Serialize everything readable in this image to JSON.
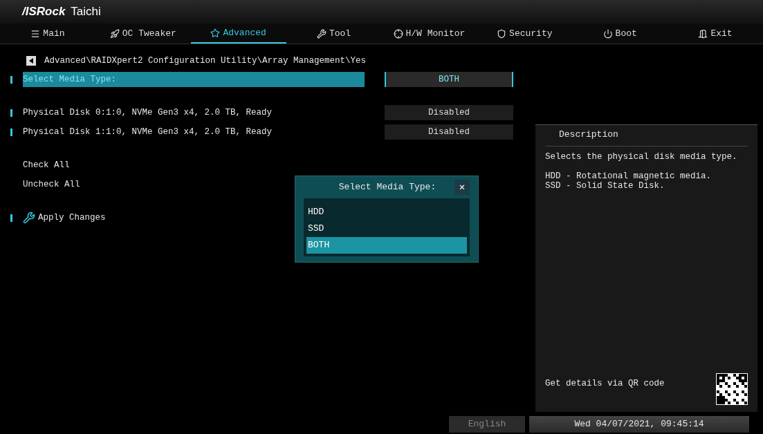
{
  "brand": {
    "logo": "/ISRock",
    "model": "Taichi"
  },
  "tabs": [
    {
      "label": "Main",
      "kind": "menu",
      "selected": false
    },
    {
      "label": "OC Tweaker",
      "kind": "rocket",
      "selected": false
    },
    {
      "label": "Advanced",
      "kind": "star",
      "selected": true
    },
    {
      "label": "Tool",
      "kind": "tools",
      "selected": false
    },
    {
      "label": "H/W Monitor",
      "kind": "target",
      "selected": false
    },
    {
      "label": "Security",
      "kind": "shield",
      "selected": false
    },
    {
      "label": "Boot",
      "kind": "power",
      "selected": false
    },
    {
      "label": "Exit",
      "kind": "door",
      "selected": false
    }
  ],
  "breadcrumb": "Advanced\\RAIDXpert2 Configuration Utility\\Array Management\\Yes",
  "groups": [
    [
      {
        "kind": "option",
        "label": "Select Media Type:",
        "value": "BOTH",
        "selected": true
      }
    ],
    [
      {
        "kind": "option",
        "label": "Physical Disk 0:1:0, NVMe Gen3 x4, 2.0 TB, Ready",
        "value": "Disabled",
        "selected": false
      },
      {
        "kind": "option",
        "label": "Physical Disk 1:1:0, NVMe Gen3 x4, 2.0 TB, Ready",
        "value": "Disabled",
        "selected": false
      }
    ],
    [
      {
        "kind": "action",
        "label": "Check All",
        "selected": false
      },
      {
        "kind": "action",
        "label": "Uncheck All",
        "selected": false
      }
    ],
    [
      {
        "kind": "apply",
        "label": "Apply Changes",
        "selected": false
      }
    ]
  ],
  "popup": {
    "title": "Select Media Type:",
    "close": "✕",
    "options": [
      {
        "label": "HDD",
        "selected": false
      },
      {
        "label": "SSD",
        "selected": false
      },
      {
        "label": "BOTH",
        "selected": true
      }
    ]
  },
  "description": {
    "title": "Description",
    "paragraphs": [
      [
        "Selects the physical disk media type."
      ],
      [
        "HDD - Rotational magnetic media.",
        "SSD - Solid State Disk."
      ]
    ],
    "qr_text": "Get details via QR code"
  },
  "status_bar": {
    "language": "English",
    "datetime": "Wed 04/07/2021, 09:45:14"
  }
}
